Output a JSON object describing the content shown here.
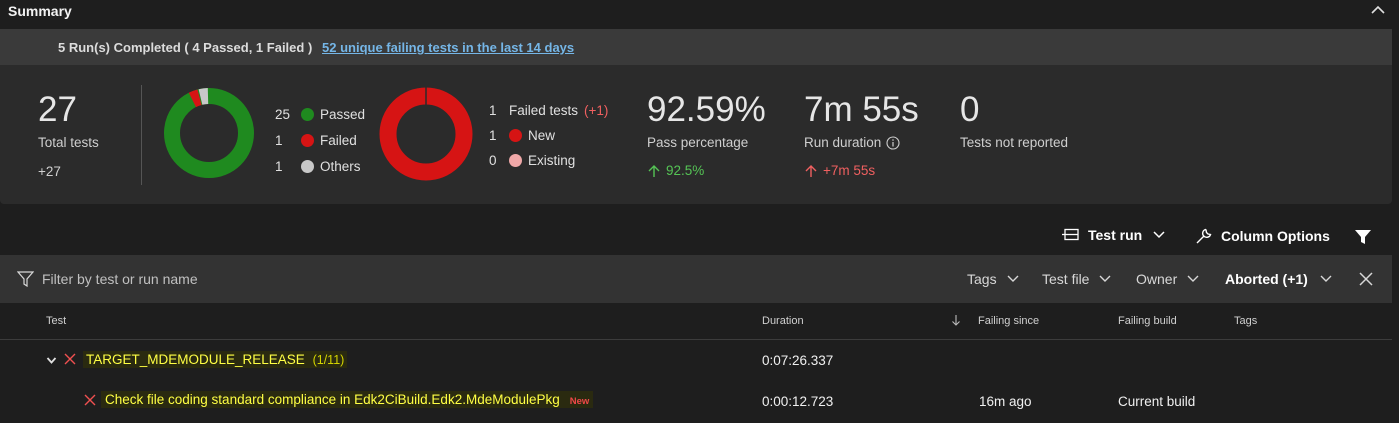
{
  "summary": {
    "title": "Summary"
  },
  "runs": {
    "text": "5 Run(s) Completed ( 4 Passed, 1 Failed )",
    "link": "52 unique failing tests in the last 14 days"
  },
  "stats": {
    "total": {
      "value": "27",
      "label": "Total tests",
      "delta": "+27"
    },
    "outcome_legend": [
      {
        "count": "25",
        "label": "Passed",
        "color": "#1f8a1f"
      },
      {
        "count": "1",
        "label": "Failed",
        "color": "#d61414"
      },
      {
        "count": "1",
        "label": "Others",
        "color": "#c8c8c8"
      }
    ],
    "failed_legend": {
      "count": "1",
      "label": "Failed tests",
      "delta": "(+1)",
      "items": [
        {
          "count": "1",
          "label": "New",
          "color": "#d61414"
        },
        {
          "count": "0",
          "label": "Existing",
          "color": "#f0a8a8"
        }
      ]
    },
    "pass": {
      "value": "92.59%",
      "label": "Pass percentage",
      "delta": "92.5%"
    },
    "duration": {
      "value": "7m 55s",
      "label": "Run duration",
      "delta": "+7m 55s"
    },
    "not_reported": {
      "value": "0",
      "label": "Tests not reported"
    }
  },
  "toolbar": {
    "test_run": "Test run",
    "column_options": "Column Options"
  },
  "filter": {
    "placeholder": "Filter by test or run name",
    "tags": "Tags",
    "test_file": "Test file",
    "owner": "Owner",
    "aborted": "Aborted (+1)"
  },
  "table": {
    "headers": {
      "test": "Test",
      "duration": "Duration",
      "failing_since": "Failing since",
      "failing_build": "Failing build",
      "tags": "Tags"
    },
    "rows": [
      {
        "name": "TARGET_MDEMODULE_RELEASE",
        "count": "(1/11)",
        "duration": "0:07:26.337",
        "failing_since": "",
        "failing_build": ""
      },
      {
        "name": "Check file coding standard compliance in Edk2CiBuild.Edk2.MdeModulePkg",
        "badge": "New",
        "duration": "0:00:12.723",
        "failing_since": "16m ago",
        "failing_build": "Current build"
      }
    ]
  },
  "colors": {
    "passed": "#1f8a1f",
    "failed": "#d61414",
    "positive": "#55c455",
    "negative": "#f06060",
    "link": "#75b6e7"
  }
}
